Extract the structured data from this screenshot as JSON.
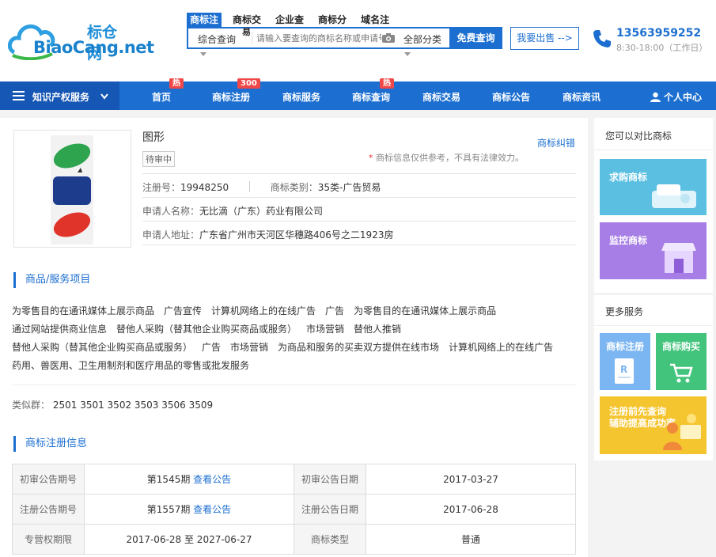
{
  "header": {
    "logo_cn": "标仓网",
    "logo_en": "BiaoCang.net",
    "search_tabs": [
      "商标注",
      "商标交",
      "企业查",
      "商标分",
      "域名注"
    ],
    "search_tab_extra": "易",
    "search_category": "综合查询",
    "search_placeholder": "请输入要查询的商标名称或申请号",
    "search_class": "全部分类",
    "search_button": "免费查询",
    "sell_button": "我要出售 -->",
    "phone": "13563959252",
    "hours": "8:30-18:00（工作日）"
  },
  "nav": {
    "category": "知识产权服务",
    "items": [
      {
        "label": "首页",
        "badge": "热"
      },
      {
        "label": "商标注册",
        "badge": "300"
      },
      {
        "label": "商标服务",
        "badge": ""
      },
      {
        "label": "商标查询",
        "badge": "热"
      },
      {
        "label": "商标交易",
        "badge": ""
      },
      {
        "label": "商标公告",
        "badge": ""
      },
      {
        "label": "商标资讯",
        "badge": ""
      }
    ],
    "user": "个人中心"
  },
  "trademark": {
    "name": "图形",
    "status": "待审中",
    "correct_link": "商标纠错",
    "note_star": "*",
    "note": "商标信息仅供参考，不具有法律效力。",
    "reg_no_label": "注册号：",
    "reg_no": "19948250",
    "class_label": "商标类别：",
    "class": "35类-广告贸易",
    "applicant_label": "申请人名称：",
    "applicant": "无比滴（广东）药业有限公司",
    "address_label": "申请人地址：",
    "address": "广东省广州市天河区华穗路406号之二1923房",
    "colors": {
      "green": "#2ea44f",
      "blue": "#1d3c8c",
      "red": "#e0342a"
    }
  },
  "goods_section": {
    "title": "商品/服务项目",
    "lines": [
      [
        "为零售目的在通讯媒体上展示商品",
        "广告宣传",
        "计算机网络上的在线广告",
        "广告",
        "为零售目的在通讯媒体上展示商品"
      ],
      [
        "通过网站提供商业信息",
        "替他人采购（替其他企业购买商品或服务）",
        "市场营销",
        "替他人推销"
      ],
      [
        "替他人采购（替其他企业购买商品或服务）",
        "广告",
        "市场营销",
        "为商品和服务的买卖双方提供在线市场",
        "计算机网络上的在线广告"
      ],
      [
        "药用、兽医用、卫生用制剂和医疗用品的零售或批发服务"
      ]
    ],
    "similar_label": "类似群：",
    "similar": "2501 3501 3502 3503 3506 3509"
  },
  "reg_section": {
    "title": "商标注册信息",
    "rows": [
      {
        "k1": "初审公告期号",
        "v1": "第1545期",
        "link1": "查看公告",
        "k2": "初审公告日期",
        "v2": "2017-03-27"
      },
      {
        "k1": "注册公告期号",
        "v1": "第1557期",
        "link1": "查看公告",
        "k2": "注册公告日期",
        "v2": "2017-06-28"
      },
      {
        "k1": "专营权期限",
        "v1": "2017-06-28 至 2027-06-27",
        "link1": "",
        "k2": "商标类型",
        "v2": "普通"
      }
    ]
  },
  "sidebar": {
    "compare_title": "您可以对比商标",
    "card_buy": "求购商标",
    "card_monitor": "监控商标",
    "more_title": "更多服务",
    "card_register": "商标注册",
    "card_purchase": "商标购买",
    "promo_line1": "注册前先查询",
    "promo_line2": "辅助提高成功率",
    "colors": {
      "buy": "#5bbfe2",
      "monitor": "#a77de6",
      "register": "#7cb6f2",
      "purchase": "#43c47c",
      "promo": "#f5c530"
    }
  }
}
